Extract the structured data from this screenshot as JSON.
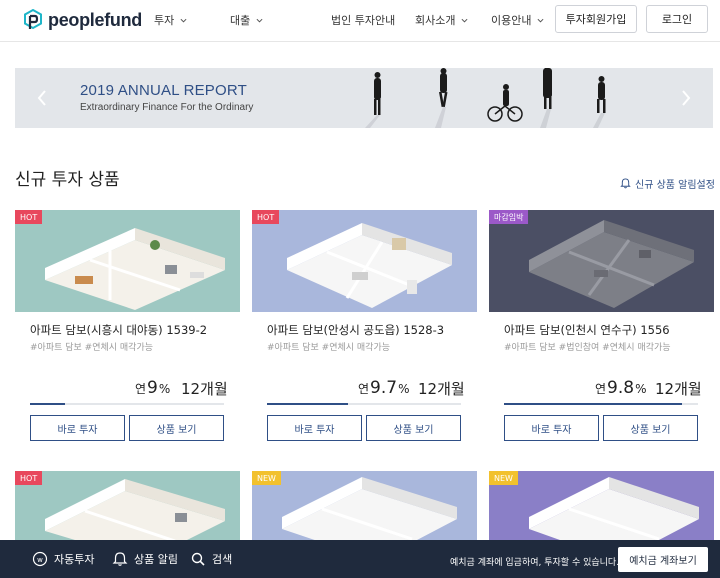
{
  "header": {
    "logo": "peoplefund",
    "nav": [
      {
        "label": "투자",
        "has_dropdown": true
      },
      {
        "label": "대출",
        "has_dropdown": true
      },
      {
        "label": "법인 투자안내",
        "has_dropdown": false
      },
      {
        "label": "회사소개",
        "has_dropdown": true
      },
      {
        "label": "이용안내",
        "has_dropdown": true
      }
    ],
    "join_button": "투자회원가입",
    "login_button": "로그인"
  },
  "banner": {
    "title": "2019 ANNUAL REPORT",
    "subtitle": "Extraordinary Finance For the Ordinary",
    "prev_icon": "chevron-left-icon",
    "next_icon": "chevron-right-icon"
  },
  "section": {
    "title": "신규 투자 상품",
    "alert_link": "신규 상품 알림설정",
    "alert_icon": "bell-icon"
  },
  "cards": [
    {
      "badge": "HOT",
      "badge_color": "#e8485d",
      "thumb_bg": "#9ec8c2",
      "title": "아파트 담보(시흥시 대야동) 1539-2",
      "tags": "#아파트 담보 #연체시 매각가능",
      "rate_prefix": "연",
      "rate_value": "9",
      "rate_unit": "%",
      "term": "12개월",
      "progress": 0.18,
      "invest_button": "바로 투자",
      "detail_button": "상품 보기"
    },
    {
      "badge": "HOT",
      "badge_color": "#e8485d",
      "thumb_bg": "#a9b7dc",
      "title": "아파트 담보(안성시 공도읍) 1528-3",
      "tags": "#아파트 담보 #연체시 매각가능",
      "rate_prefix": "연",
      "rate_value": "9.7",
      "rate_unit": "%",
      "term": "12개월",
      "progress": 0.42,
      "invest_button": "바로 투자",
      "detail_button": "상품 보기"
    },
    {
      "badge": "마감임박",
      "badge_color": "#9b59c8",
      "thumb_bg": "#4b4f64",
      "title": "아파트 담보(인천시 연수구) 1556",
      "tags": "#아파트 담보 #법인참여 #연체시 매각가능",
      "rate_prefix": "연",
      "rate_value": "9.8",
      "rate_unit": "%",
      "term": "12개월",
      "progress": 0.92,
      "invest_button": "바로 투자",
      "detail_button": "상품 보기"
    }
  ],
  "cards_row2": [
    {
      "badge": "HOT",
      "badge_color": "#e8485d",
      "thumb_bg": "#9ec8c2"
    },
    {
      "badge": "NEW",
      "badge_color": "#f2c12e",
      "thumb_bg": "#a9b7dc"
    },
    {
      "badge": "NEW",
      "badge_color": "#f2c12e",
      "thumb_bg": "#8a7fc7"
    }
  ],
  "bottombar": {
    "items": [
      {
        "label": "자동투자",
        "icon": "auto-invest-icon"
      },
      {
        "label": "상품 알림",
        "icon": "bell-icon"
      },
      {
        "label": "검색",
        "icon": "search-icon"
      }
    ],
    "message": "예치금 계좌에 입금하여, 투자할 수 있습니다.",
    "cta_button": "예치금 계좌보기"
  },
  "colors": {
    "brand_navy": "#1f2a3d",
    "accent_blue": "#2f4f86",
    "hot_red": "#e8485d",
    "new_yellow": "#f2c12e",
    "closing_purple": "#9b59c8"
  }
}
